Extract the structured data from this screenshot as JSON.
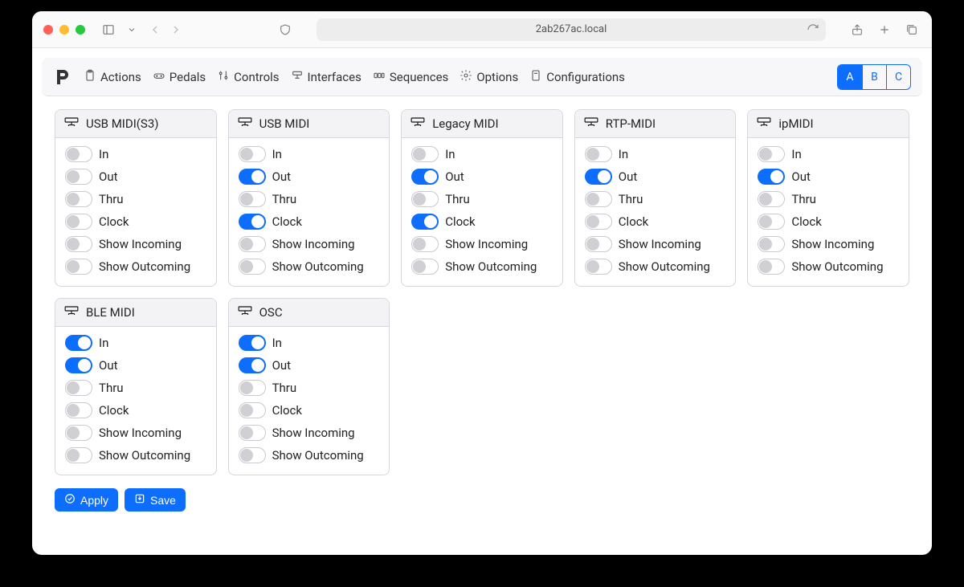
{
  "browser": {
    "address": "2ab267ac.local"
  },
  "nav": {
    "links": [
      {
        "label": "Actions"
      },
      {
        "label": "Pedals"
      },
      {
        "label": "Controls"
      },
      {
        "label": "Interfaces"
      },
      {
        "label": "Sequences"
      },
      {
        "label": "Options"
      },
      {
        "label": "Configurations"
      }
    ],
    "segments": [
      "A",
      "B",
      "C"
    ],
    "segment_active": 0
  },
  "option_labels": [
    "In",
    "Out",
    "Thru",
    "Clock",
    "Show Incoming",
    "Show Outcoming"
  ],
  "interfaces": [
    {
      "title": "USB MIDI(S3)",
      "values": [
        false,
        false,
        false,
        false,
        false,
        false
      ]
    },
    {
      "title": "USB MIDI",
      "values": [
        false,
        true,
        false,
        true,
        false,
        false
      ]
    },
    {
      "title": "Legacy MIDI",
      "values": [
        false,
        true,
        false,
        true,
        false,
        false
      ]
    },
    {
      "title": "RTP-MIDI",
      "values": [
        false,
        true,
        false,
        false,
        false,
        false
      ]
    },
    {
      "title": "ipMIDI",
      "values": [
        false,
        true,
        false,
        false,
        false,
        false
      ]
    },
    {
      "title": "BLE MIDI",
      "values": [
        true,
        true,
        false,
        false,
        false,
        false
      ]
    },
    {
      "title": "OSC",
      "values": [
        true,
        true,
        false,
        false,
        false,
        false
      ]
    }
  ],
  "buttons": {
    "apply": "Apply",
    "save": "Save"
  }
}
